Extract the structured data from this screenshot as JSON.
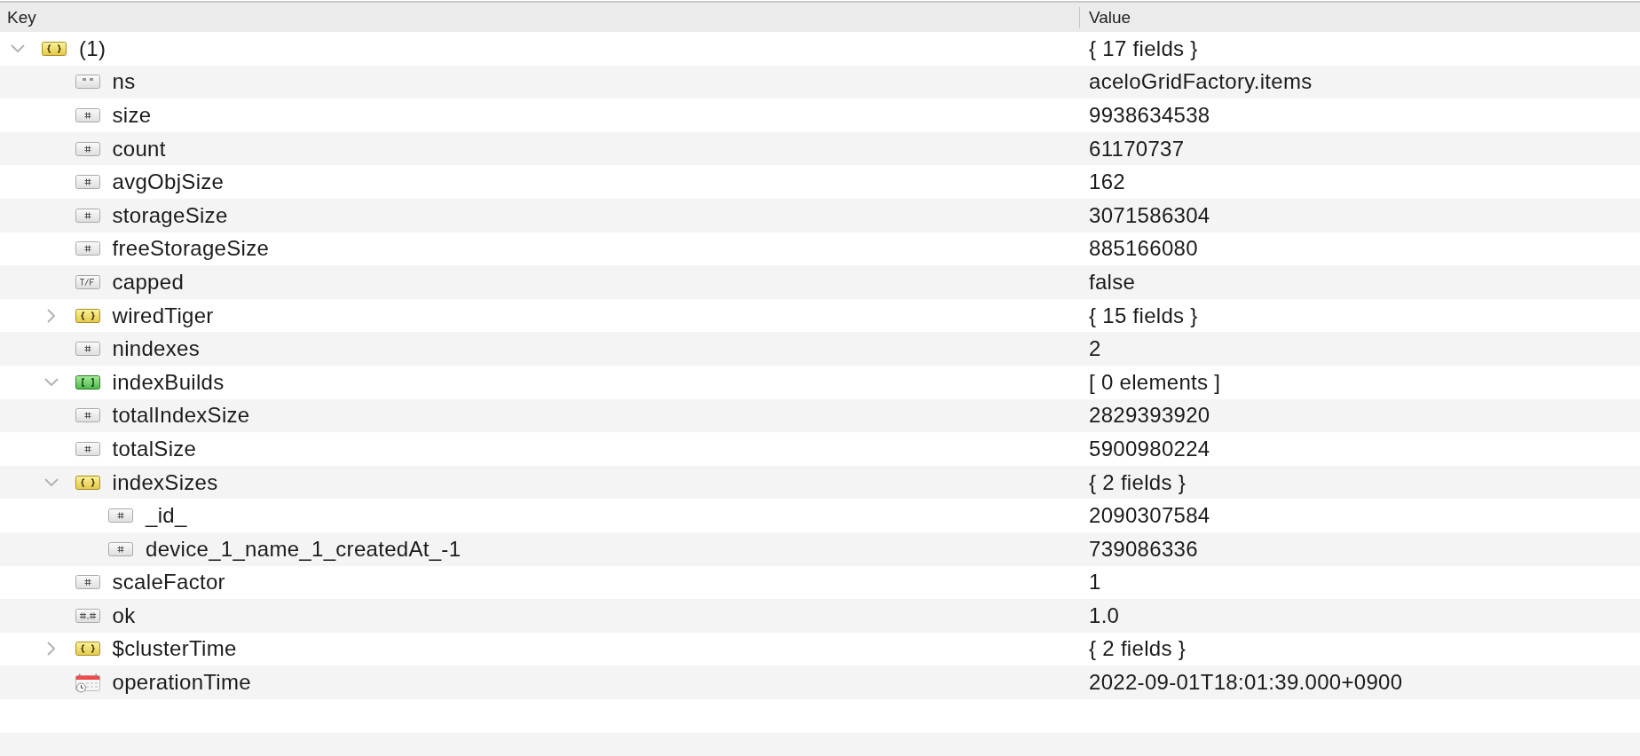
{
  "columns": [
    {
      "label": "Key"
    },
    {
      "label": "Value"
    }
  ],
  "tree": [
    {
      "key": "(1)",
      "kind": "object",
      "expanded": true,
      "value": "{ 17 fields }",
      "children": [
        {
          "key": "ns",
          "kind": "string",
          "value": "aceloGridFactory.items"
        },
        {
          "key": "size",
          "kind": "int",
          "value": "9938634538"
        },
        {
          "key": "count",
          "kind": "int",
          "value": "61170737"
        },
        {
          "key": "avgObjSize",
          "kind": "int",
          "value": "162"
        },
        {
          "key": "storageSize",
          "kind": "int",
          "value": "3071586304"
        },
        {
          "key": "freeStorageSize",
          "kind": "int",
          "value": "885166080"
        },
        {
          "key": "capped",
          "kind": "bool",
          "value": "false"
        },
        {
          "key": "wiredTiger",
          "kind": "object",
          "expanded": false,
          "value": "{ 15 fields }"
        },
        {
          "key": "nindexes",
          "kind": "int",
          "value": "2"
        },
        {
          "key": "indexBuilds",
          "kind": "array",
          "expanded": true,
          "value": "[ 0 elements ]"
        },
        {
          "key": "totalIndexSize",
          "kind": "int",
          "value": "2829393920"
        },
        {
          "key": "totalSize",
          "kind": "int",
          "value": "5900980224"
        },
        {
          "key": "indexSizes",
          "kind": "object",
          "expanded": true,
          "value": "{ 2 fields }",
          "children": [
            {
              "key": "_id_",
              "kind": "int",
              "value": "2090307584"
            },
            {
              "key": "device_1_name_1_createdAt_-1",
              "kind": "int",
              "value": "739086336"
            }
          ]
        },
        {
          "key": "scaleFactor",
          "kind": "int",
          "value": "1"
        },
        {
          "key": "ok",
          "kind": "double",
          "value": "1.0"
        },
        {
          "key": "$clusterTime",
          "kind": "object",
          "expanded": false,
          "value": "{ 2 fields }"
        },
        {
          "key": "operationTime",
          "kind": "date",
          "value": "2022-09-01T18:01:39.000+0900"
        }
      ]
    }
  ]
}
